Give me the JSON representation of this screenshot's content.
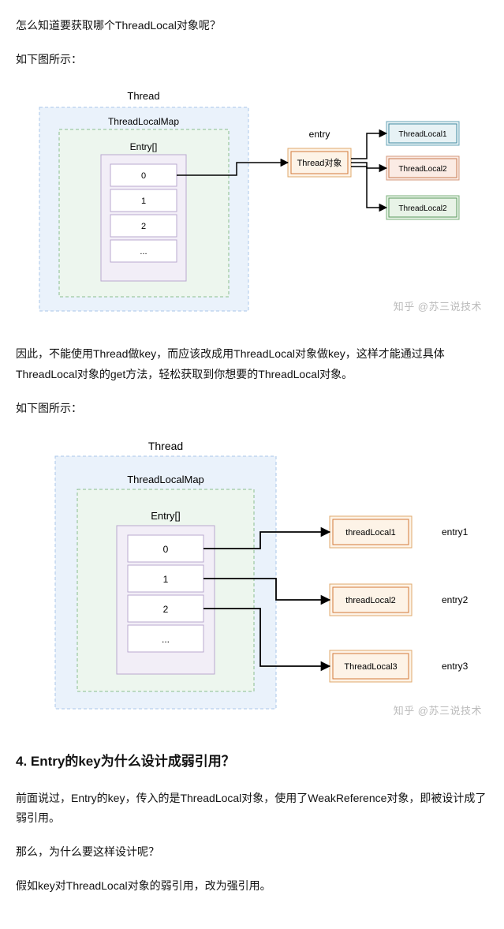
{
  "paragraphs": {
    "p1": "怎么知道要获取哪个ThreadLocal对象呢？",
    "p2": "如下图所示：",
    "p3": "因此，不能使用Thread做key，而应该改成用ThreadLocal对象做key，这样才能通过具体ThreadLocal对象的get方法，轻松获取到你想要的ThreadLocal对象。",
    "p4": "如下图所示：",
    "p5": "前面说过，Entry的key，传入的是ThreadLocal对象，使用了WeakReference对象，即被设计成了弱引用。",
    "p6": "那么，为什么要这样设计呢？",
    "p7": "假如key对ThreadLocal对象的弱引用，改为强引用。"
  },
  "heading4": "4. Entry的key为什么设计成弱引用？",
  "watermark": "知乎 @苏三说技术",
  "diagram1": {
    "thread": "Thread",
    "map": "ThreadLocalMap",
    "entryArr": "Entry[]",
    "cells": [
      "0",
      "1",
      "2",
      "..."
    ],
    "entryLabel": "entry",
    "entryBox": "Thread对象",
    "tl": [
      "ThreadLocal1",
      "ThreadLocal2",
      "ThreadLocal2"
    ]
  },
  "diagram2": {
    "thread": "Thread",
    "map": "ThreadLocalMap",
    "entryArr": "Entry[]",
    "cells": [
      "0",
      "1",
      "2",
      "..."
    ],
    "tl": [
      "threadLocal1",
      "threadLocal2",
      "ThreadLocal3"
    ],
    "entryLabels": [
      "entry1",
      "entry2",
      "entry3"
    ]
  }
}
